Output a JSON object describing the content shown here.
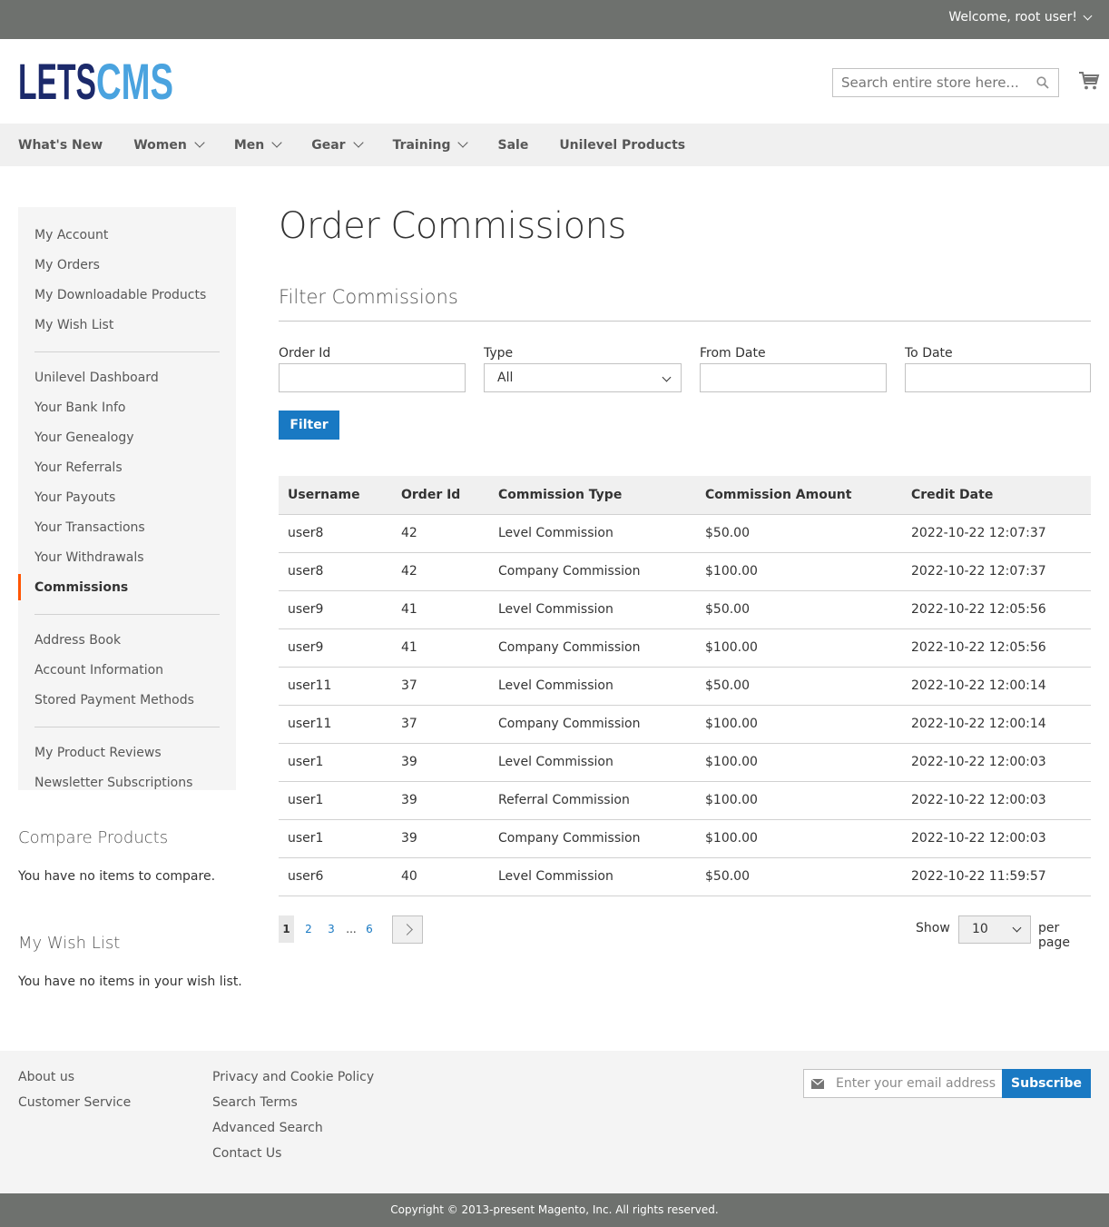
{
  "topbar": {
    "welcome": "Welcome, root user!"
  },
  "logo": {
    "part1": "LETS",
    "part2": "CMS"
  },
  "search": {
    "placeholder": "Search entire store here..."
  },
  "nav": [
    {
      "label": "What's New",
      "dropdown": false
    },
    {
      "label": "Women",
      "dropdown": true
    },
    {
      "label": "Men",
      "dropdown": true
    },
    {
      "label": "Gear",
      "dropdown": true
    },
    {
      "label": "Training",
      "dropdown": true
    },
    {
      "label": "Sale",
      "dropdown": false
    },
    {
      "label": "Unilevel Products",
      "dropdown": false
    }
  ],
  "sidebar": {
    "group1": [
      "My Account",
      "My Orders",
      "My Downloadable Products",
      "My Wish List"
    ],
    "group2": [
      "Unilevel Dashboard",
      "Your Bank Info",
      "Your Genealogy",
      "Your Referrals",
      "Your Payouts",
      "Your Transactions",
      "Your Withdrawals",
      "Commissions"
    ],
    "group3": [
      "Address Book",
      "Account Information",
      "Stored Payment Methods"
    ],
    "group4": [
      "My Product Reviews",
      "Newsletter Subscriptions"
    ],
    "active": "Commissions"
  },
  "compare": {
    "title": "Compare Products",
    "empty": "You have no items to compare."
  },
  "wishlist": {
    "title": "My Wish List",
    "empty": "You have no items in your wish list."
  },
  "page": {
    "title": "Order Commissions"
  },
  "filter": {
    "title": "Filter Commissions",
    "order_id_label": "Order Id",
    "type_label": "Type",
    "type_value": "All",
    "from_label": "From Date",
    "to_label": "To Date",
    "button": "Filter"
  },
  "table": {
    "headers": [
      "Username",
      "Order Id",
      "Commission Type",
      "Commission Amount",
      "Credit Date"
    ],
    "rows": [
      [
        "user8",
        "42",
        "Level Commission",
        "$50.00",
        "2022-10-22 12:07:37"
      ],
      [
        "user8",
        "42",
        "Company Commission",
        "$100.00",
        "2022-10-22 12:07:37"
      ],
      [
        "user9",
        "41",
        "Level Commission",
        "$50.00",
        "2022-10-22 12:05:56"
      ],
      [
        "user9",
        "41",
        "Company Commission",
        "$100.00",
        "2022-10-22 12:05:56"
      ],
      [
        "user11",
        "37",
        "Level Commission",
        "$50.00",
        "2022-10-22 12:00:14"
      ],
      [
        "user11",
        "37",
        "Company Commission",
        "$100.00",
        "2022-10-22 12:00:14"
      ],
      [
        "user1",
        "39",
        "Level Commission",
        "$100.00",
        "2022-10-22 12:00:03"
      ],
      [
        "user1",
        "39",
        "Referral Commission",
        "$100.00",
        "2022-10-22 12:00:03"
      ],
      [
        "user1",
        "39",
        "Company Commission",
        "$100.00",
        "2022-10-22 12:00:03"
      ],
      [
        "user6",
        "40",
        "Level Commission",
        "$50.00",
        "2022-10-22 11:59:57"
      ]
    ]
  },
  "pager": {
    "pages": [
      "1",
      "2",
      "3",
      "...",
      "6"
    ],
    "current": "1",
    "show_label": "Show",
    "limit": "10",
    "per_page_label": "per page"
  },
  "footer": {
    "col1": [
      "About us",
      "Customer Service"
    ],
    "col2": [
      "Privacy and Cookie Policy",
      "Search Terms",
      "Advanced Search",
      "Contact Us"
    ],
    "newsletter_placeholder": "Enter your email address",
    "subscribe": "Subscribe",
    "copyright": "Copyright © 2013-present Magento, Inc. All rights reserved."
  },
  "colors": {
    "accent": "#1979c3",
    "active_marker": "#ff5501",
    "logo_dark": "#1c2a6b",
    "logo_light": "#4aa3df"
  }
}
